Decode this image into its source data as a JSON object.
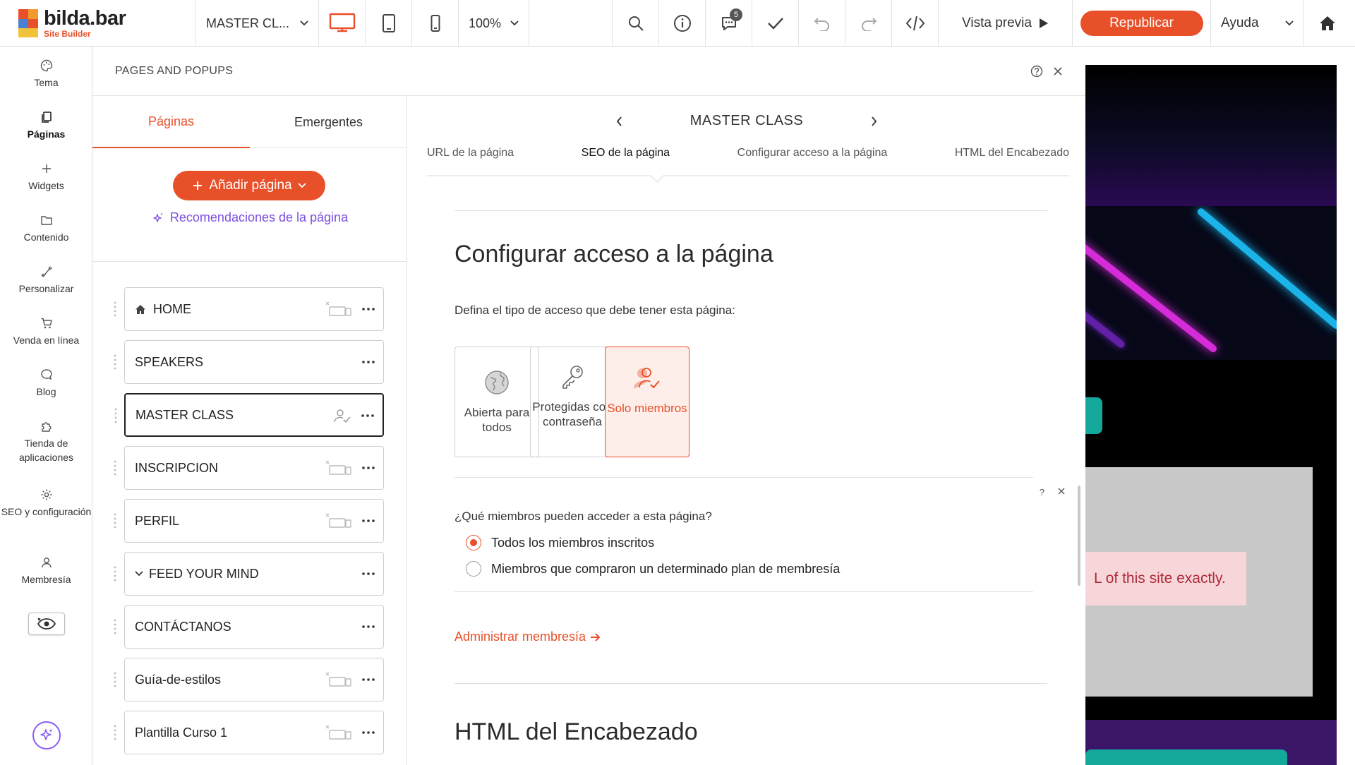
{
  "app": {
    "logo_name": "bilda.bar",
    "logo_sub": "Site Builder"
  },
  "topbar": {
    "page_select": "MASTER CL...",
    "zoom": "100%",
    "comments_badge": "5",
    "preview_label": "Vista previa",
    "publish_label": "Republicar",
    "help_label": "Ayuda",
    "accent_color": "#e8502a"
  },
  "rail": {
    "items": [
      {
        "label": "Tema",
        "icon": "palette-icon"
      },
      {
        "label": "Páginas",
        "icon": "pages-icon"
      },
      {
        "label": "Widgets",
        "icon": "plus-icon"
      },
      {
        "label": "Contenido",
        "icon": "folder-icon"
      },
      {
        "label": "Personalizar",
        "icon": "customize-icon"
      },
      {
        "label": "Venda en línea",
        "icon": "cart-icon"
      },
      {
        "label": "Blog",
        "icon": "chat-bubble-icon"
      },
      {
        "label": "Tienda de aplicaciones",
        "icon": "puzzle-icon"
      },
      {
        "label": "SEO y configuración",
        "icon": "gear-icon"
      },
      {
        "label": "Membresía",
        "icon": "member-icon"
      }
    ]
  },
  "panel": {
    "title": "PAGES AND POPUPS",
    "tabs": [
      "Páginas",
      "Emergentes"
    ],
    "add_page_label": "Añadir página",
    "recommendations_label": "Recomendaciones de la página",
    "pages": [
      {
        "name": "HOME"
      },
      {
        "name": "SPEAKERS"
      },
      {
        "name": "MASTER CLASS"
      },
      {
        "name": "INSCRIPCION"
      },
      {
        "name": "PERFIL"
      },
      {
        "name": "FEED YOUR MIND"
      },
      {
        "name": "CONTÁCTANOS"
      },
      {
        "name": "Guía-de-estilos"
      },
      {
        "name": "Plantilla Curso 1"
      }
    ]
  },
  "content": {
    "page_name": "MASTER CLASS",
    "tabs": [
      "URL de la página",
      "SEO de la página",
      "Configurar acceso a la página",
      "HTML del Encabezado"
    ],
    "access_title": "Configurar acceso a la página",
    "access_prompt": "Defina el tipo de acceso que debe tener esta página:",
    "access_options": [
      {
        "label": "Abierta para todos",
        "icon": "globe-icon"
      },
      {
        "label": "Protegidas con contraseña",
        "icon": "key-icon"
      },
      {
        "label": "Solo miembros",
        "icon": "members-only-icon",
        "selected": true
      }
    ],
    "members_question": "¿Qué miembros pueden acceder a esta página?",
    "member_options": [
      {
        "label": "Todos los miembros inscritos",
        "checked": true
      },
      {
        "label": "Miembros que compraron un determinado plan de membresía",
        "checked": false
      }
    ],
    "manage_link": "Administrar membresía",
    "header_html_title": "HTML del Encabezado"
  },
  "canvas": {
    "alert_text": "L of this site exactly."
  }
}
